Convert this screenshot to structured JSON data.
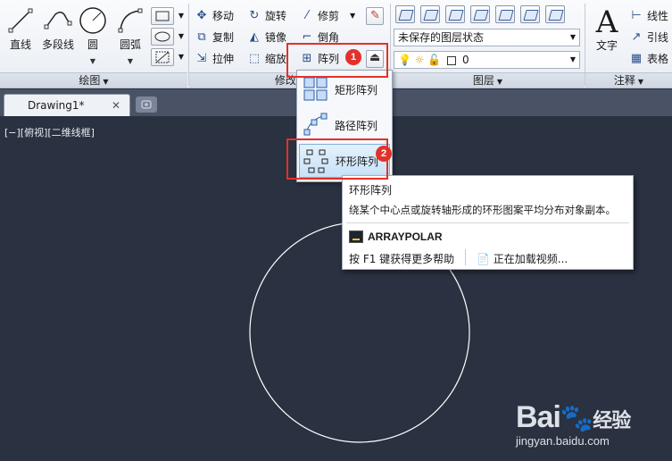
{
  "ribbon": {
    "draw_panel": {
      "title": "绘图",
      "tools": [
        "直线",
        "多段线",
        "圆",
        "圆弧"
      ]
    },
    "modify_panel": {
      "title": "修改",
      "items": [
        {
          "label": "移动",
          "icon": "move-icon"
        },
        {
          "label": "旋转",
          "icon": "rotate-icon"
        },
        {
          "label": "修剪",
          "icon": "trim-icon"
        },
        {
          "label": "复制",
          "icon": "copy-icon"
        },
        {
          "label": "镜像",
          "icon": "mirror-icon"
        },
        {
          "label": "倒角",
          "icon": "chamfer-icon"
        },
        {
          "label": "拉伸",
          "icon": "stretch-icon"
        },
        {
          "label": "缩放",
          "icon": "scale-icon"
        },
        {
          "label": "阵列",
          "icon": "array-icon"
        }
      ]
    },
    "layers_panel": {
      "title": "图层",
      "layer_state": "未保存的图层状态",
      "current_layer": "0"
    },
    "annotation_panel": {
      "title": "注释",
      "text_label": "文字",
      "items": [
        "线性",
        "引线",
        "表格"
      ]
    }
  },
  "tabs": {
    "document": "Drawing1*",
    "close": "✕"
  },
  "canvas": {
    "view_label": "[−][俯视][二维线框]"
  },
  "array_menu": {
    "items": [
      {
        "label": "矩形阵列",
        "icon": "rect-array-icon"
      },
      {
        "label": "路径阵列",
        "icon": "path-array-icon"
      },
      {
        "label": "环形阵列",
        "icon": "polar-array-icon"
      }
    ]
  },
  "tooltip": {
    "title": "环形阵列",
    "description": "绕某个中心点或旋转轴形成的环形图案平均分布对象副本。",
    "command": "ARRAYPOLAR",
    "help": "按 F1 键获得更多帮助",
    "video": "正在加载视频..."
  },
  "annotations": {
    "badge1": "1",
    "badge2": "2"
  },
  "watermark": {
    "brand": "Bai",
    "brand2": "经验",
    "url": "jingyan.baidu.com"
  },
  "colors": {
    "canvas_bg": "#2a3140",
    "highlight": "#e3312a",
    "menu_active": "#c8e2f8"
  }
}
